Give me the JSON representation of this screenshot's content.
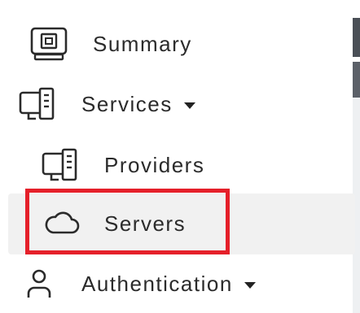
{
  "nav": {
    "summary": {
      "label": "Summary",
      "icon": "summary-monitor-icon"
    },
    "services": {
      "label": "Services",
      "icon": "services-desktop-icon",
      "expanded": true
    },
    "providers": {
      "label": "Providers",
      "icon": "providers-desktop-icon"
    },
    "servers": {
      "label": "Servers",
      "icon": "cloud-icon",
      "selected": true
    },
    "authentication": {
      "label": "Authentication",
      "icon": "user-icon",
      "expanded": false
    }
  },
  "colors": {
    "highlight": "#e5202a",
    "selected_background": "#f1f1f1",
    "text": "#2b2b2b"
  }
}
